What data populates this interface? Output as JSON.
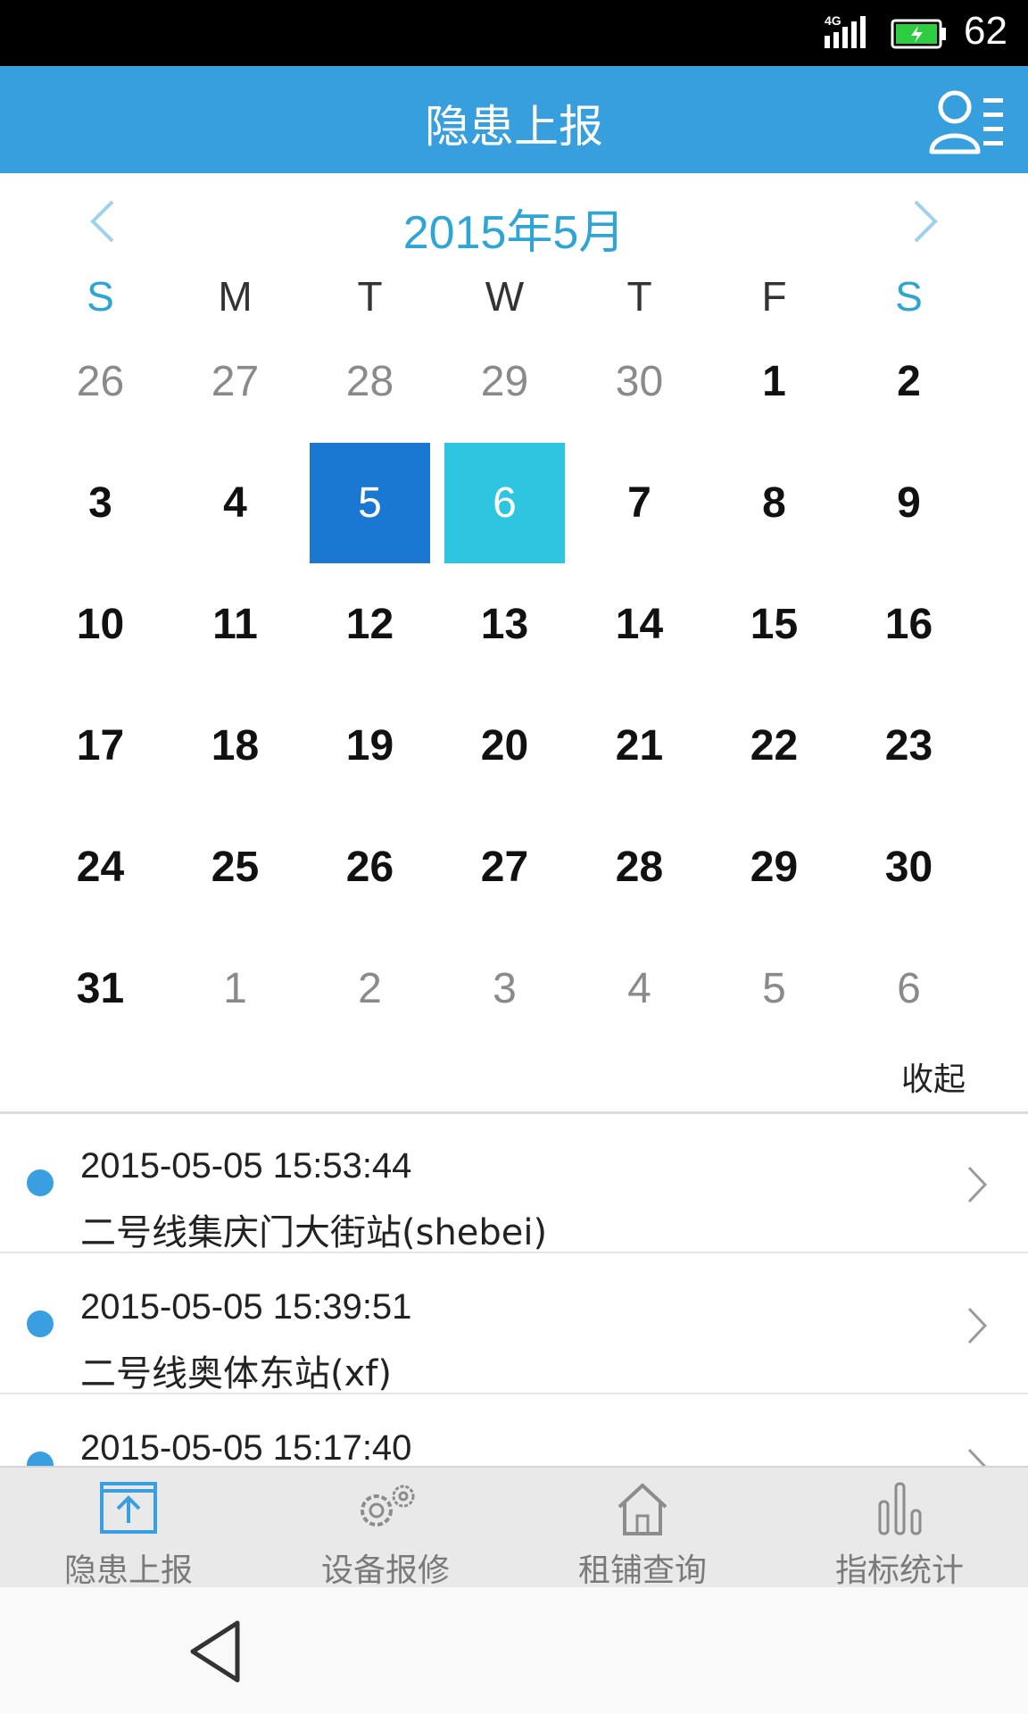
{
  "status_bar": {
    "network": "4G",
    "battery_percent": "62"
  },
  "title_bar": {
    "title": "隐患上报",
    "user_icon": "user-list-icon"
  },
  "calendar": {
    "month_label": "2015年5月",
    "prev_icon": "chevron-left-icon",
    "next_icon": "chevron-right-icon",
    "weekdays": [
      "S",
      "M",
      "T",
      "W",
      "T",
      "F",
      "S"
    ],
    "weeks": [
      [
        {
          "d": "26",
          "t": "other"
        },
        {
          "d": "27",
          "t": "other"
        },
        {
          "d": "28",
          "t": "other"
        },
        {
          "d": "29",
          "t": "other"
        },
        {
          "d": "30",
          "t": "other"
        },
        {
          "d": "1",
          "t": "cur"
        },
        {
          "d": "2",
          "t": "cur"
        }
      ],
      [
        {
          "d": "3",
          "t": "cur"
        },
        {
          "d": "4",
          "t": "cur"
        },
        {
          "d": "5",
          "t": "sel"
        },
        {
          "d": "6",
          "t": "today"
        },
        {
          "d": "7",
          "t": "cur"
        },
        {
          "d": "8",
          "t": "cur"
        },
        {
          "d": "9",
          "t": "cur"
        }
      ],
      [
        {
          "d": "10",
          "t": "cur"
        },
        {
          "d": "11",
          "t": "cur"
        },
        {
          "d": "12",
          "t": "cur"
        },
        {
          "d": "13",
          "t": "cur"
        },
        {
          "d": "14",
          "t": "cur"
        },
        {
          "d": "15",
          "t": "cur"
        },
        {
          "d": "16",
          "t": "cur"
        }
      ],
      [
        {
          "d": "17",
          "t": "cur"
        },
        {
          "d": "18",
          "t": "cur"
        },
        {
          "d": "19",
          "t": "cur"
        },
        {
          "d": "20",
          "t": "cur"
        },
        {
          "d": "21",
          "t": "cur"
        },
        {
          "d": "22",
          "t": "cur"
        },
        {
          "d": "23",
          "t": "cur"
        }
      ],
      [
        {
          "d": "24",
          "t": "cur"
        },
        {
          "d": "25",
          "t": "cur"
        },
        {
          "d": "26",
          "t": "cur"
        },
        {
          "d": "27",
          "t": "cur"
        },
        {
          "d": "28",
          "t": "cur"
        },
        {
          "d": "29",
          "t": "cur"
        },
        {
          "d": "30",
          "t": "cur"
        }
      ],
      [
        {
          "d": "31",
          "t": "cur"
        },
        {
          "d": "1",
          "t": "other"
        },
        {
          "d": "2",
          "t": "other"
        },
        {
          "d": "3",
          "t": "other"
        },
        {
          "d": "4",
          "t": "other"
        },
        {
          "d": "5",
          "t": "other"
        },
        {
          "d": "6",
          "t": "other"
        }
      ]
    ],
    "collapse_label": "收起"
  },
  "reports": [
    {
      "time": "2015-05-05 15:53:44",
      "name": "二号线集庆门大街站(shebei)"
    },
    {
      "time": "2015-05-05 15:39:51",
      "name": "二号线奥体东站(xf)"
    },
    {
      "time": "2015-05-05 15:17:40",
      "name": ""
    }
  ],
  "tabs": [
    {
      "label": "隐患上报",
      "icon": "upload-report-icon",
      "active": true
    },
    {
      "label": "设备报修",
      "icon": "gears-icon",
      "active": false
    },
    {
      "label": "租铺查询",
      "icon": "home-icon",
      "active": false
    },
    {
      "label": "指标统计",
      "icon": "bar-chart-icon",
      "active": false
    }
  ],
  "colors": {
    "primary": "#379fde",
    "selected_day": "#1a78d2",
    "today": "#2ec5e0",
    "accent_text": "#2ea6d4",
    "status_dot": "#3a9fe0"
  }
}
